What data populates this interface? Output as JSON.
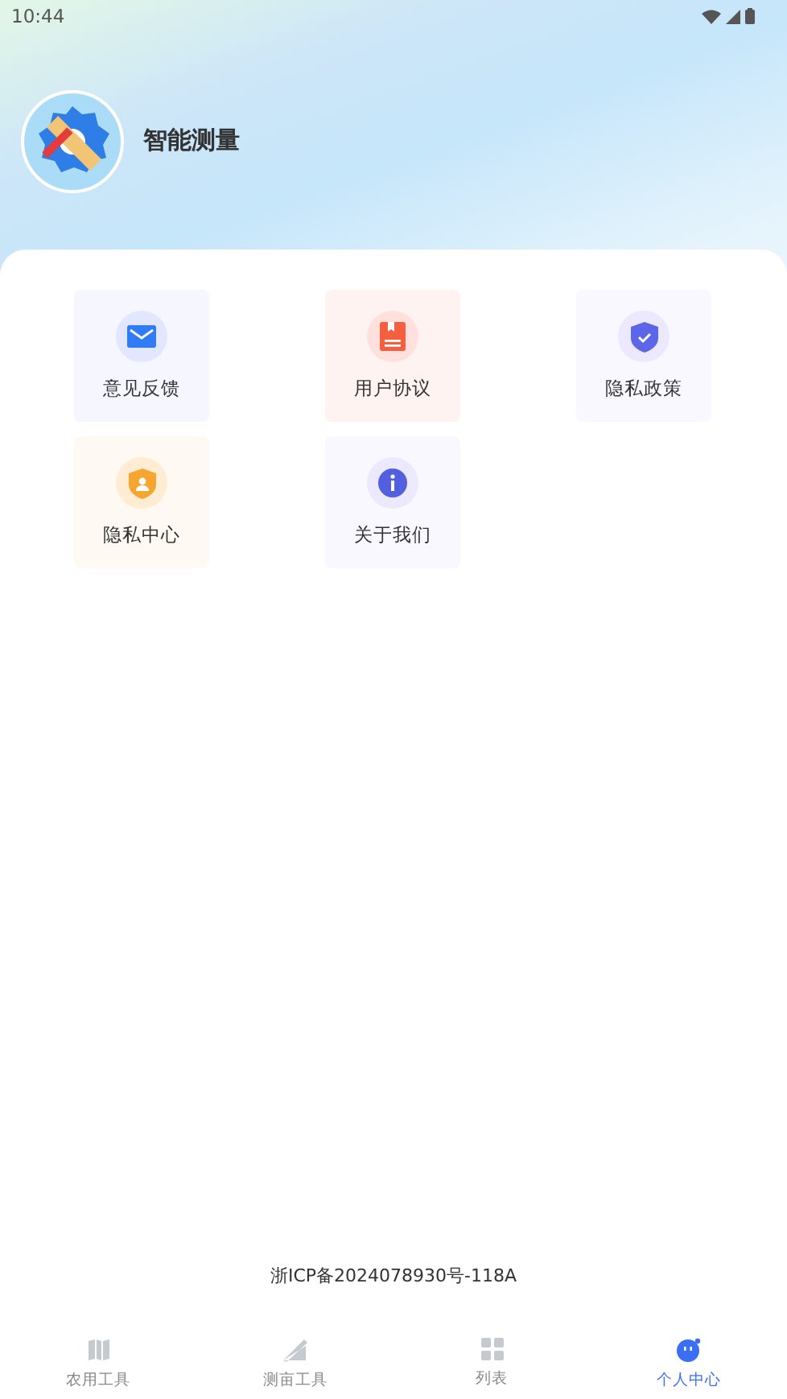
{
  "status_bar": {
    "time": "10:44"
  },
  "profile": {
    "name": "智能测量"
  },
  "menu": [
    {
      "label": "意见反馈",
      "kind": "mail"
    },
    {
      "label": "用户协议",
      "kind": "book"
    },
    {
      "label": "隐私政策",
      "kind": "shield-check"
    },
    {
      "label": "隐私中心",
      "kind": "shield-user"
    },
    {
      "label": "关于我们",
      "kind": "info"
    }
  ],
  "footer": {
    "icp": "浙ICP备2024078930号-118A"
  },
  "tabs": [
    {
      "label": "农用工具",
      "kind": "map",
      "selected": false
    },
    {
      "label": "测亩工具",
      "kind": "ruler",
      "selected": false
    },
    {
      "label": "列表",
      "kind": "grid",
      "selected": false
    },
    {
      "label": "个人中心",
      "kind": "person",
      "selected": true
    }
  ]
}
